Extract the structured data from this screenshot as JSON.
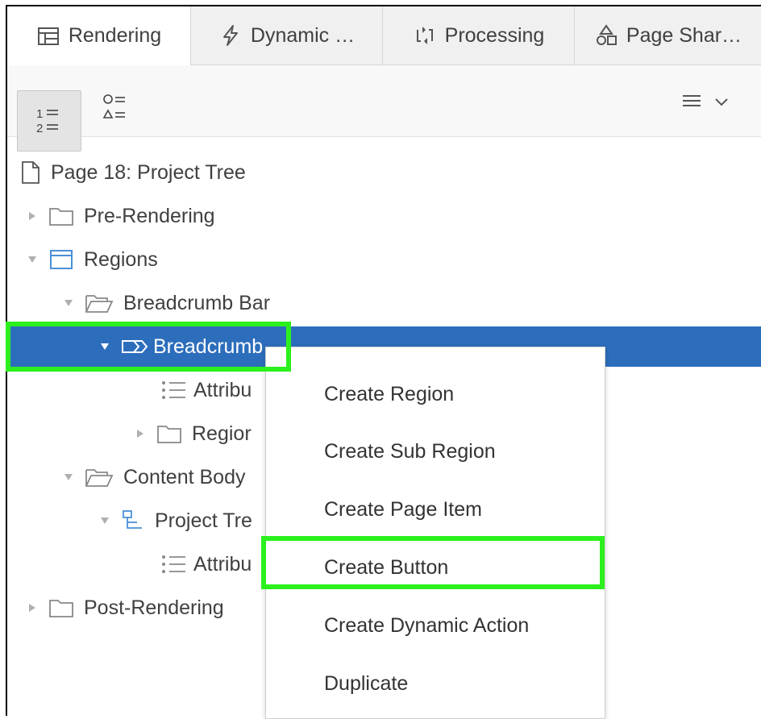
{
  "tabs": [
    {
      "label": "Rendering",
      "icon": "table-icon",
      "active": true
    },
    {
      "label": "Dynamic …",
      "icon": "lightning-icon",
      "active": false
    },
    {
      "label": "Processing",
      "icon": "process-arrows-icon",
      "active": false
    },
    {
      "label": "Page Shar…",
      "icon": "shapes-icon",
      "active": false
    }
  ],
  "toolbar": {
    "ordered_view_icon": "numbered-list-icon",
    "grouped_view_icon": "shape-list-icon",
    "menu_icon": "hamburger-menu-icon"
  },
  "tree": [
    {
      "label": "Page 18: Project Tree",
      "icon": "page-icon"
    },
    {
      "label": "Pre-Rendering",
      "icon": "folder-icon"
    },
    {
      "label": "Regions",
      "icon": "region-icon"
    },
    {
      "label": "Breadcrumb Bar",
      "icon": "folder-open-icon"
    },
    {
      "label": "Breadcrumb",
      "icon": "breadcrumb-icon",
      "selected": true
    },
    {
      "label": "Attribu",
      "icon": "attributes-icon"
    },
    {
      "label": "Regior",
      "icon": "folder-icon"
    },
    {
      "label": "Content Body",
      "icon": "folder-open-icon"
    },
    {
      "label": "Project Tre",
      "icon": "tree-region-icon"
    },
    {
      "label": "Attribu",
      "icon": "attributes-icon"
    },
    {
      "label": "Post-Rendering",
      "icon": "folder-icon"
    }
  ],
  "context_menu": {
    "items": [
      "Create Region",
      "Create Sub Region",
      "Create Page Item",
      "Create Button",
      "Create Dynamic Action",
      "Duplicate"
    ]
  },
  "colors": {
    "selection": "#2d6ebc",
    "highlight": "#2cf01e",
    "tab_bar": "#f0f0f0",
    "region_icon": "#4a90d9"
  }
}
